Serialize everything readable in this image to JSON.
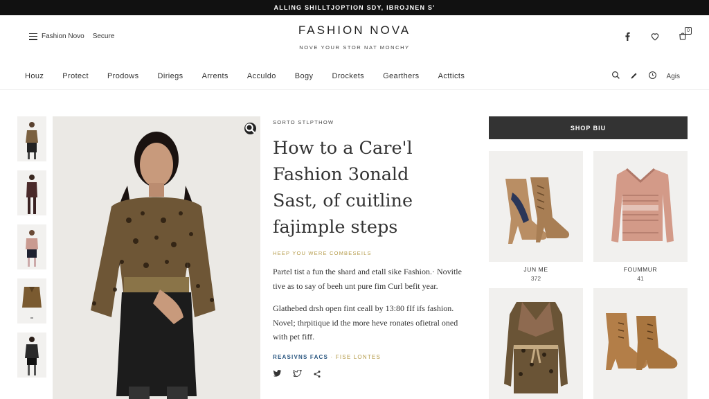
{
  "announcement": "ALLING SHILLTJOPTION SDY, IBROJNEN S'",
  "header": {
    "menu_label": "Fashion Novo",
    "secure_label": "Secure",
    "brand_title": "FASHION NOVA",
    "brand_tagline": "NOVE   YOUR STOR   NAT MONCHY",
    "icons": [
      "facebook-icon",
      "heart-icon",
      "cart-icon"
    ],
    "cart_count": "0"
  },
  "nav": {
    "items": [
      "Houz",
      "Protect",
      "Prodows",
      "Diriegs",
      "Arrents",
      "Acculdo",
      "Bogy",
      "Drockets",
      "Gearthers",
      "Actticts"
    ],
    "right_label": "Agis",
    "right_icons": [
      "search-icon",
      "pen-icon",
      "clock-icon"
    ]
  },
  "gallery": {
    "thumbnail_count": 5
  },
  "article": {
    "eyebrow": "SORTO STLPTHOW",
    "headline_lines": [
      "How to a Care'l",
      "Fashion 3onald",
      "Sast, of cuitline",
      "fajimple steps"
    ],
    "subheading": "HEEP YOU WERE COMBESEILS",
    "paragraph1": "Partel tist a fun the shard and etall sike Fashion.· Novitle tive as to say of beeh unt pure fim Curl befit year.",
    "paragraph2": "Glathebed drsh open fint ceall by 13:80 fIf ifs fashion. Novel; thrpitique id the more heve ronates ofietral oned with pet fiff.",
    "tag_primary": "REASIVNS FACS",
    "tag_secondary": " · FISE LONTES",
    "social_icons": [
      "twitter-icon",
      "bird-icon",
      "share-icon"
    ]
  },
  "shop": {
    "button_label": "SHOP BIU",
    "products": [
      {
        "name": "JUN ME",
        "price": "372"
      },
      {
        "name": "FOUMMUR",
        "price": "41"
      },
      {
        "name": "",
        "price": ""
      },
      {
        "name": "",
        "price": ""
      }
    ]
  },
  "colors": {
    "announcement_bg": "#111111",
    "shop_button_bg": "#333333",
    "accent_gold": "#b49a48",
    "accent_blue": "#2a5680"
  }
}
